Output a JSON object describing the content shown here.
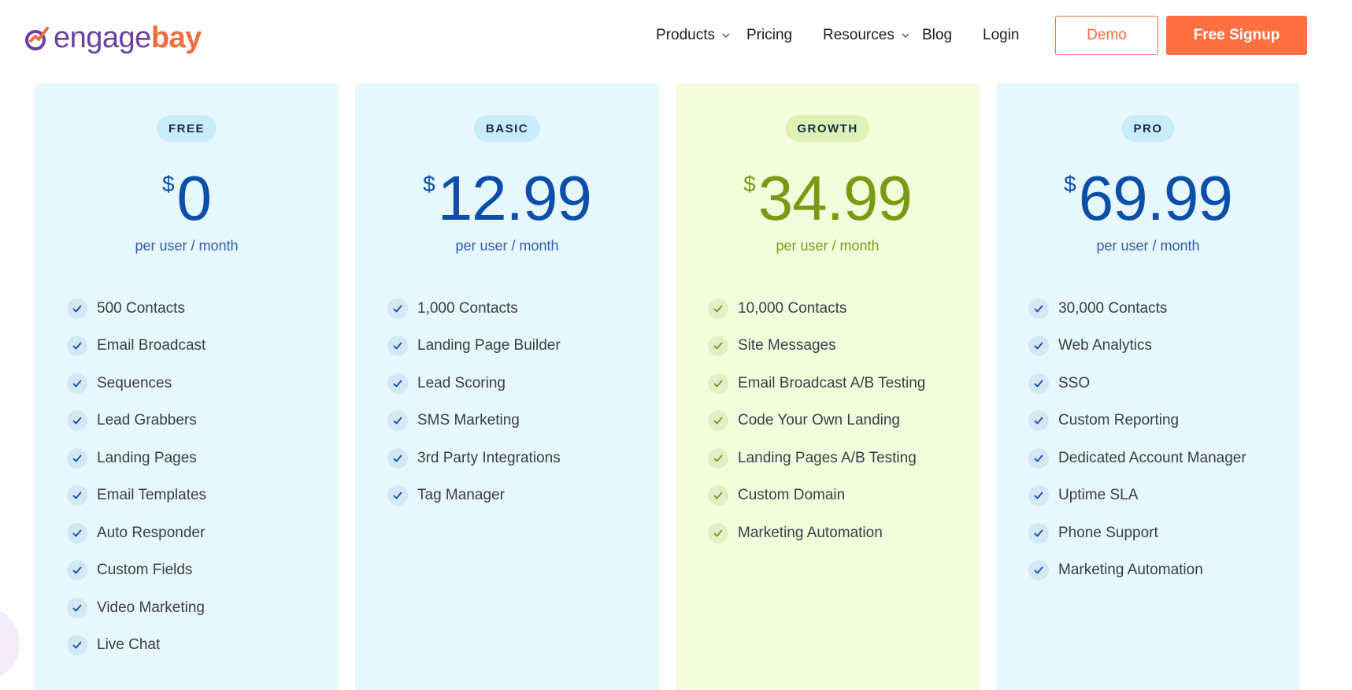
{
  "brand": {
    "engage": "engage",
    "bay": "bay",
    "colors": {
      "purple": "#6c3fa0",
      "orange": "#f26c3c"
    }
  },
  "nav": {
    "products": "Products",
    "pricing": "Pricing",
    "resources": "Resources",
    "blog": "Blog",
    "login": "Login"
  },
  "buttons": {
    "demo": "Demo",
    "signup": "Free Signup"
  },
  "plans": [
    {
      "name": "FREE",
      "currency": "$",
      "price": "0",
      "period": "per user / month",
      "features": [
        "500 Contacts",
        "Email Broadcast",
        "Sequences",
        "Lead Grabbers",
        "Landing Pages",
        "Email Templates",
        "Auto Responder",
        "Custom Fields",
        "Video Marketing",
        "Live Chat"
      ]
    },
    {
      "name": "BASIC",
      "currency": "$",
      "price": "12.99",
      "period": "per user / month",
      "features": [
        "1,000 Contacts",
        "Landing Page Builder",
        "Lead Scoring",
        "SMS Marketing",
        "3rd Party Integrations",
        "Tag Manager"
      ]
    },
    {
      "name": "GROWTH",
      "currency": "$",
      "price": "34.99",
      "period": "per user / month",
      "features": [
        "10,000 Contacts",
        "Site Messages",
        "Email Broadcast A/B Testing",
        "Code Your Own Landing",
        "Landing Pages A/B Testing",
        "Custom Domain",
        "Marketing Automation"
      ]
    },
    {
      "name": "PRO",
      "currency": "$",
      "price": "69.99",
      "period": "per user / month",
      "features": [
        "30,000 Contacts",
        "Web Analytics",
        "SSO",
        "Custom Reporting",
        "Dedicated Account Manager",
        "Uptime SLA",
        "Phone Support",
        "Marketing Automation"
      ]
    }
  ],
  "icons": {
    "check": "check-icon",
    "chevron": "chevron-down-icon"
  }
}
